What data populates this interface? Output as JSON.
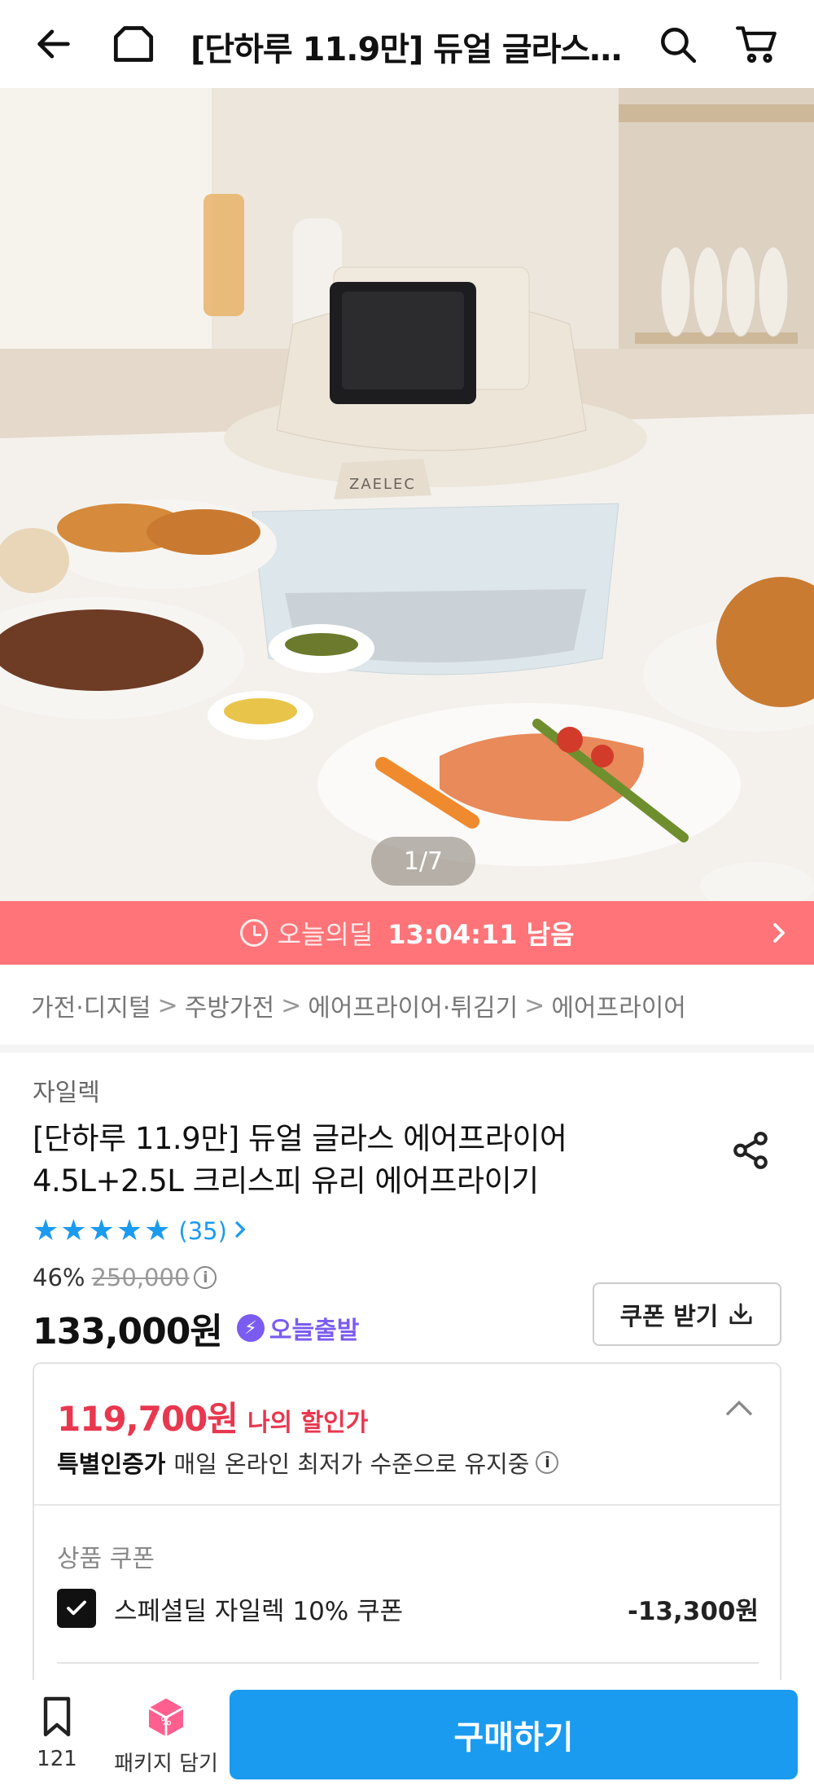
{
  "header": {
    "title": "[단하루 11.9만] 듀얼 글라스 에어프라이어 4.5L+2.5L 크리스피 유리 에어프라이기",
    "back_icon": "back-arrow-icon",
    "home_icon": "home-icon",
    "search_icon": "search-icon",
    "cart_icon": "cart-icon"
  },
  "gallery": {
    "counter": "1/7",
    "product_logo": "ZAELEC"
  },
  "deal": {
    "label": "오늘의딜",
    "time": "13:04:11 남음",
    "color": "#ff7478"
  },
  "breadcrumb": [
    "가전·디지털",
    "주방가전",
    "에어프라이어·튀김기",
    "에어프라이어"
  ],
  "product": {
    "brand": "자일렉",
    "title": "[단하루 11.9만] 듀얼 글라스 에어프라이어 4.5L+2.5L 크리스피 유리 에어프라이기",
    "rating": 5,
    "stars": "★★★★★",
    "review_count": "(35)",
    "discount_pct": "46%",
    "original_price": "250,000",
    "price": "133,000원",
    "delivery_badge": "오늘출발",
    "coupon_button": "쿠폰 받기"
  },
  "my_price": {
    "amount": "119,700원",
    "label": "나의 할인가",
    "cert_title": "특별인증가",
    "cert_text": "매일 온라인 최저가 수준으로 유지중",
    "section_title": "상품 쿠폰",
    "coupon_name": "스페셜딜 자일렉 10% 쿠폰",
    "coupon_value": "-13,300원",
    "accent": "#e8384f"
  },
  "bottom_bar": {
    "wish_count": "121",
    "package_label": "패키지 담기",
    "buy_label": "구매하기",
    "buy_color": "#1a9bf0"
  }
}
